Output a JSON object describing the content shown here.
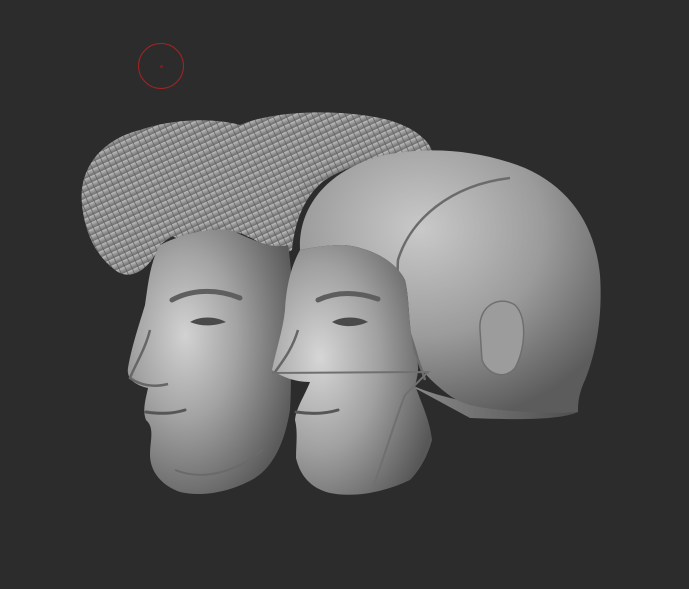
{
  "app": {
    "name": "",
    "view": "3d-sculpt-viewport"
  },
  "viewport": {
    "background_color": "#2c2c2c",
    "material_color": "#9a9a9a",
    "cursor_color": "#a12424"
  },
  "models": [
    {
      "id": "head-with-hair",
      "description_icon": "sculpted-head-hair"
    },
    {
      "id": "head-with-cowl",
      "description_icon": "sculpted-head-cowl"
    }
  ]
}
